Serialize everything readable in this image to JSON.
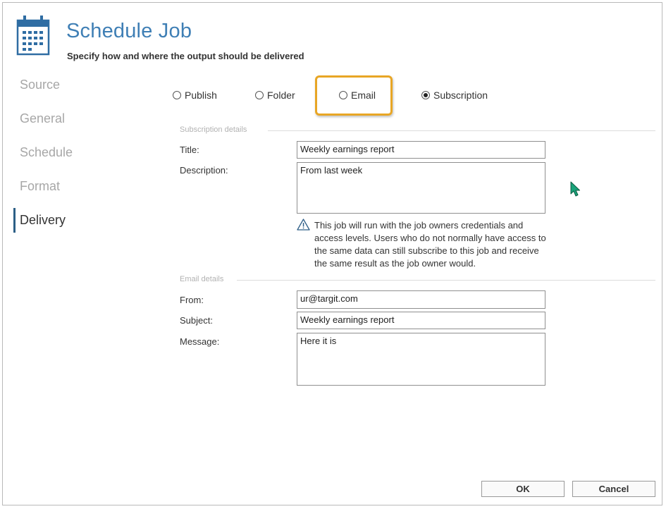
{
  "header": {
    "title": "Schedule Job",
    "subtitle": "Specify how and where the output should be delivered",
    "icon": "calendar-icon"
  },
  "sidebar": {
    "items": [
      {
        "label": "Source",
        "active": false
      },
      {
        "label": "General",
        "active": false
      },
      {
        "label": "Schedule",
        "active": false
      },
      {
        "label": "Format",
        "active": false
      },
      {
        "label": "Delivery",
        "active": true
      }
    ]
  },
  "delivery_options": {
    "options": [
      {
        "label": "Publish",
        "selected": false
      },
      {
        "label": "Folder",
        "selected": false
      },
      {
        "label": "Email",
        "selected": false
      },
      {
        "label": "Subscription",
        "selected": true
      }
    ],
    "highlight_color": "#e8a625"
  },
  "subscription": {
    "section_label": "Subscription details",
    "title_label": "Title:",
    "title_value": "Weekly earnings report",
    "description_label": "Description:",
    "description_value": "From last week",
    "warning_text": "This job will run with the job owners credentials and access levels. Users who do not normally have access to the same data can still subscribe to this job and receive the same result as the job owner would."
  },
  "email": {
    "section_label": "Email details",
    "from_label": "From:",
    "from_value": "ur@targit.com",
    "subject_label": "Subject:",
    "subject_value": "Weekly earnings report",
    "message_label": "Message:",
    "message_value": "Here it is"
  },
  "footer": {
    "ok_label": "OK",
    "cancel_label": "Cancel"
  },
  "colors": {
    "title": "#3f7fb5",
    "active_marker": "#2c5f86",
    "cursor": "#1aa37a"
  }
}
